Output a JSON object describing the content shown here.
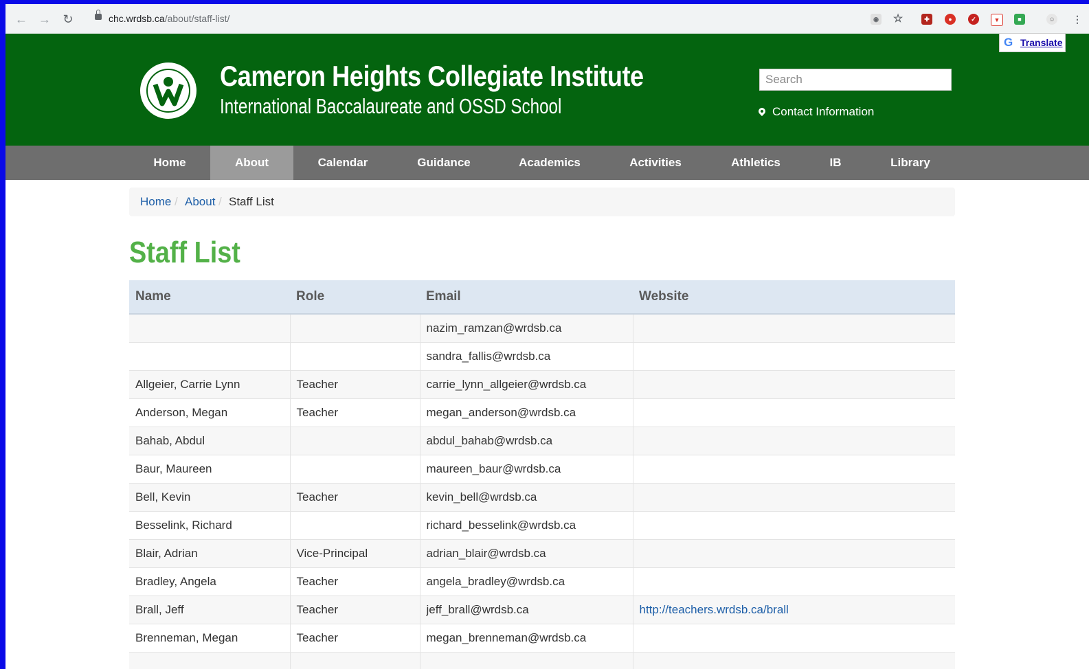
{
  "browser": {
    "url_domain": "chc.wrdsb.ca",
    "url_path": "/about/staff-list/",
    "translate_label": "Translate"
  },
  "header": {
    "title": "Cameron Heights Collegiate Institute",
    "subtitle": "International Baccalaureate and OSSD School",
    "search_placeholder": "Search",
    "contact_label": "Contact Information"
  },
  "nav": {
    "items": [
      "Home",
      "About",
      "Calendar",
      "Guidance",
      "Academics",
      "Activities",
      "Athletics",
      "IB",
      "Library"
    ],
    "active": "About"
  },
  "breadcrumb": {
    "home": "Home",
    "about": "About",
    "current": "Staff List",
    "separator": "/"
  },
  "page_title": "Staff List",
  "table": {
    "headers": [
      "Name",
      "Role",
      "Email",
      "Website"
    ],
    "rows": [
      {
        "name": "",
        "role": "",
        "email": "nazim_ramzan@wrdsb.ca",
        "website": ""
      },
      {
        "name": "",
        "role": "",
        "email": "sandra_fallis@wrdsb.ca",
        "website": ""
      },
      {
        "name": "Allgeier, Carrie Lynn",
        "role": "Teacher",
        "email": "carrie_lynn_allgeier@wrdsb.ca",
        "website": ""
      },
      {
        "name": "Anderson, Megan",
        "role": "Teacher",
        "email": "megan_anderson@wrdsb.ca",
        "website": ""
      },
      {
        "name": "Bahab, Abdul",
        "role": "",
        "email": "abdul_bahab@wrdsb.ca",
        "website": ""
      },
      {
        "name": "Baur, Maureen",
        "role": "",
        "email": "maureen_baur@wrdsb.ca",
        "website": ""
      },
      {
        "name": "Bell, Kevin",
        "role": "Teacher",
        "email": "kevin_bell@wrdsb.ca",
        "website": ""
      },
      {
        "name": "Besselink, Richard",
        "role": "",
        "email": "richard_besselink@wrdsb.ca",
        "website": ""
      },
      {
        "name": "Blair, Adrian",
        "role": "Vice-Principal",
        "email": "adrian_blair@wrdsb.ca",
        "website": ""
      },
      {
        "name": "Bradley, Angela",
        "role": "Teacher",
        "email": "angela_bradley@wrdsb.ca",
        "website": ""
      },
      {
        "name": "Brall, Jeff",
        "role": "Teacher",
        "email": "jeff_brall@wrdsb.ca",
        "website": "http://teachers.wrdsb.ca/brall"
      },
      {
        "name": "Brenneman, Megan",
        "role": "Teacher",
        "email": "megan_brenneman@wrdsb.ca",
        "website": ""
      }
    ]
  },
  "colors": {
    "header_green": "#04640f",
    "title_green": "#53b148",
    "nav_gray": "#6e6e6e",
    "link_blue": "#1e5fa8"
  }
}
